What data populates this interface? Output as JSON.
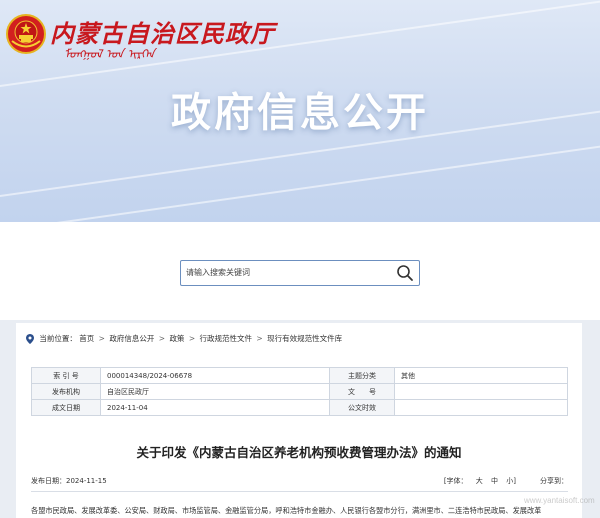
{
  "header": {
    "logo_chinese": "内蒙古自治区民政厅",
    "logo_mongolian": "ᠮᠣᠩᠭᠣᠯ ᠤᠨ ᠢᠷᠭᠡᠨ",
    "banner_title": "政府信息公开"
  },
  "search": {
    "placeholder": "请输入搜索关键词"
  },
  "breadcrumb": {
    "prefix": "当前位置：",
    "items": [
      "首页",
      "政府信息公开",
      "政策",
      "行政规范性文件",
      "现行有效规范性文件库"
    ],
    "separator": ">"
  },
  "meta": {
    "rows": [
      {
        "label1": "索 引 号",
        "value1": "000014348/2024-06678",
        "label2": "主题分类",
        "value2": "其他"
      },
      {
        "label1": "发布机构",
        "value1": "自治区民政厅",
        "label2": "文　　号",
        "value2": ""
      },
      {
        "label1": "成文日期",
        "value1": "2024-11-04",
        "label2": "公文时效",
        "value2": ""
      }
    ]
  },
  "document": {
    "title": "关于印发《内蒙古自治区养老机构预收费管理办法》的通知",
    "publish_date": "发布日期：2024-11-15",
    "font_label": "[字体：",
    "font_large": "大",
    "font_medium": "中",
    "font_small": "小]",
    "share_label": "分享到：",
    "body_first_line": "各盟市民政局、发展改革委、公安局、财政局、市场监管局、金融监管分局，呼和浩特市金融办、人民银行各盟市分行，满洲里市、二连浩特市民政局、发展改革"
  },
  "watermark": "www.yantaisoft.com",
  "colors": {
    "logo_red": "#c8181e",
    "search_border": "#6c8fbf",
    "banner_blue": "#c2d3ee"
  }
}
